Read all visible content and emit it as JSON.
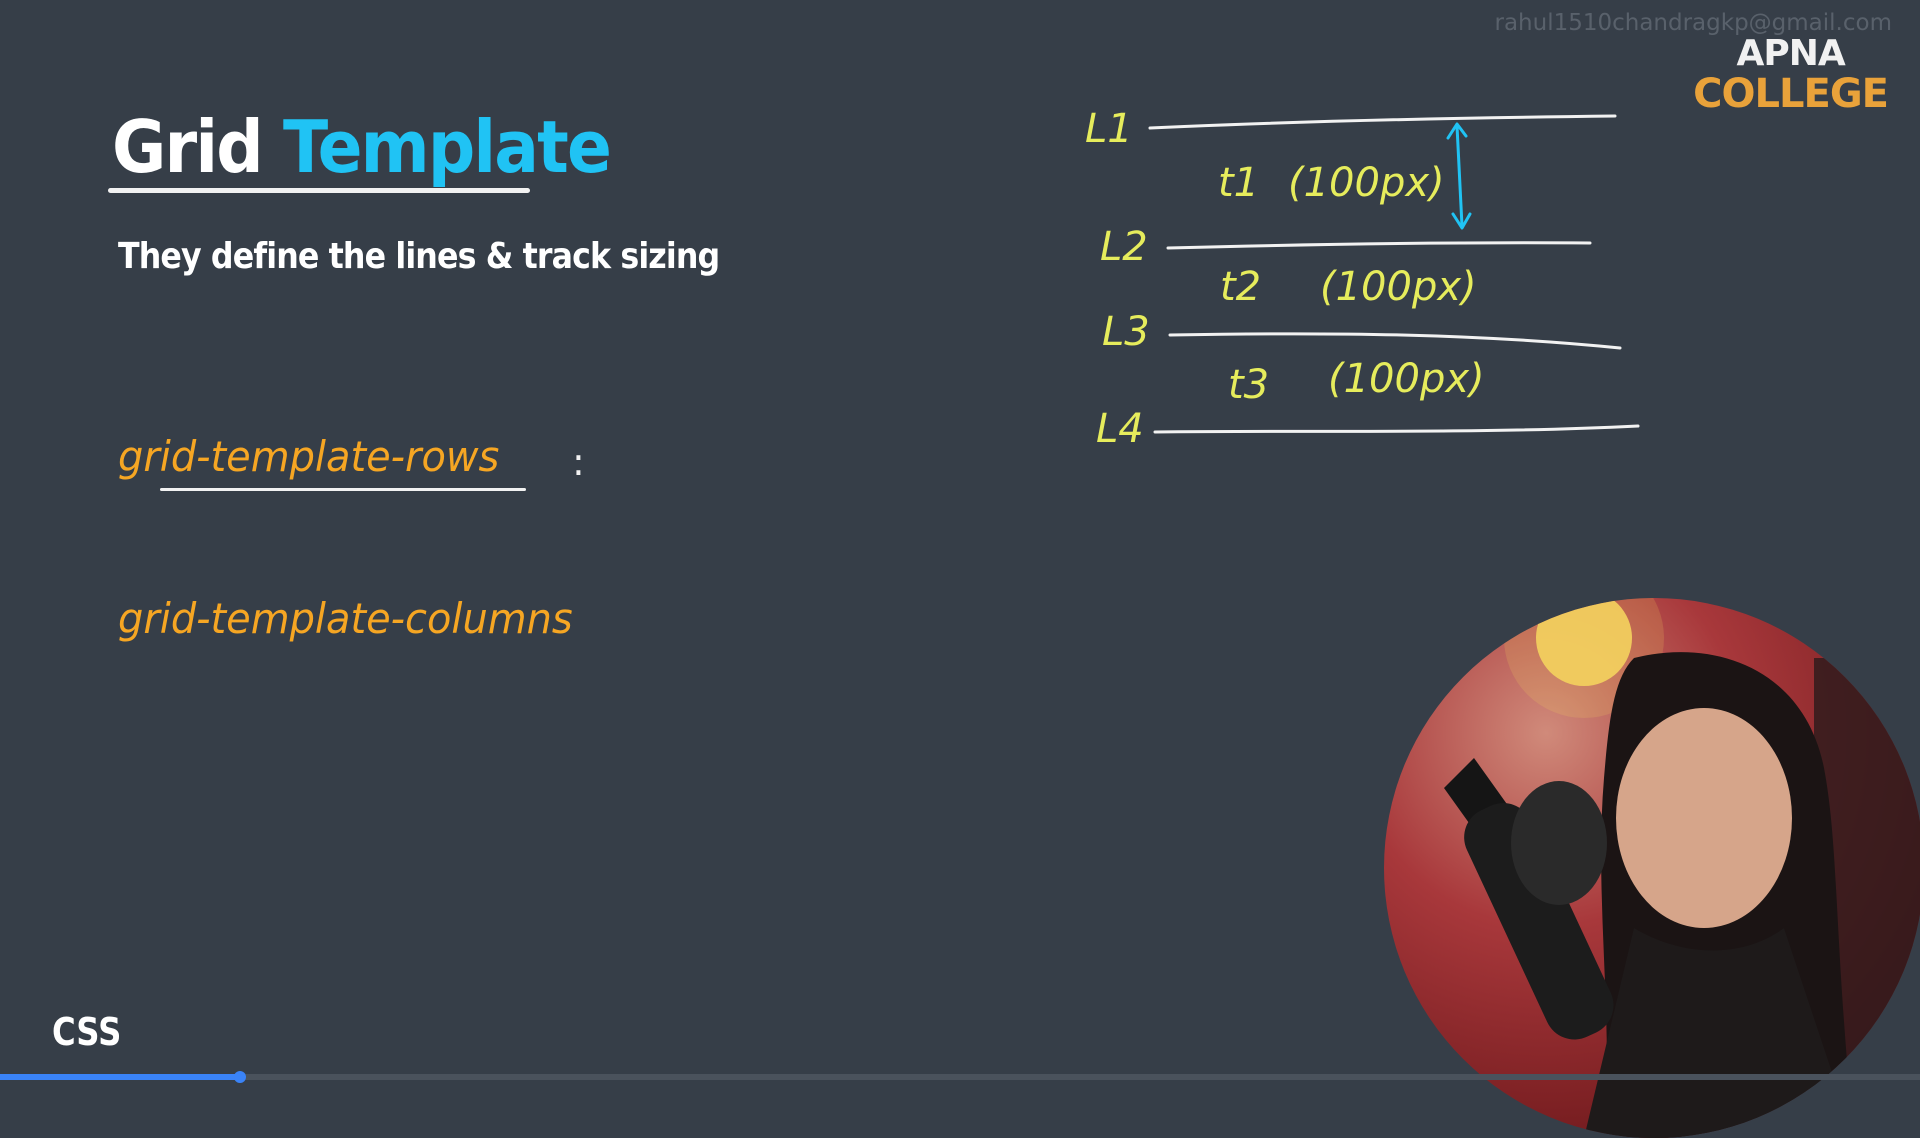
{
  "watermark": "rahul1510chandragkp@gmail.com",
  "logo": {
    "line1": "APNA",
    "line2": "COLLEGE"
  },
  "slide": {
    "title_word1": "Grid",
    "title_word2": "Template",
    "subtitle": "They define the lines & track sizing",
    "property_rows": "grid-template-rows",
    "colon": ":",
    "property_columns": "grid-template-columns",
    "footer_label": "CSS"
  },
  "sketch": {
    "lines": [
      "L1",
      "L2",
      "L3",
      "L4"
    ],
    "tracks": [
      {
        "name": "t1",
        "size": "(100px)"
      },
      {
        "name": "t2",
        "size": "(100px)"
      },
      {
        "name": "t3",
        "size": "(100px)"
      }
    ]
  },
  "video": {
    "progress_percent": 12.5
  },
  "colors": {
    "background": "#363e48",
    "title_accent": "#20c3f4",
    "property_text": "#f6a623",
    "handwriting": "#e6ec5c",
    "arrow": "#20c3f4",
    "logo_orange": "#e9a23a"
  }
}
